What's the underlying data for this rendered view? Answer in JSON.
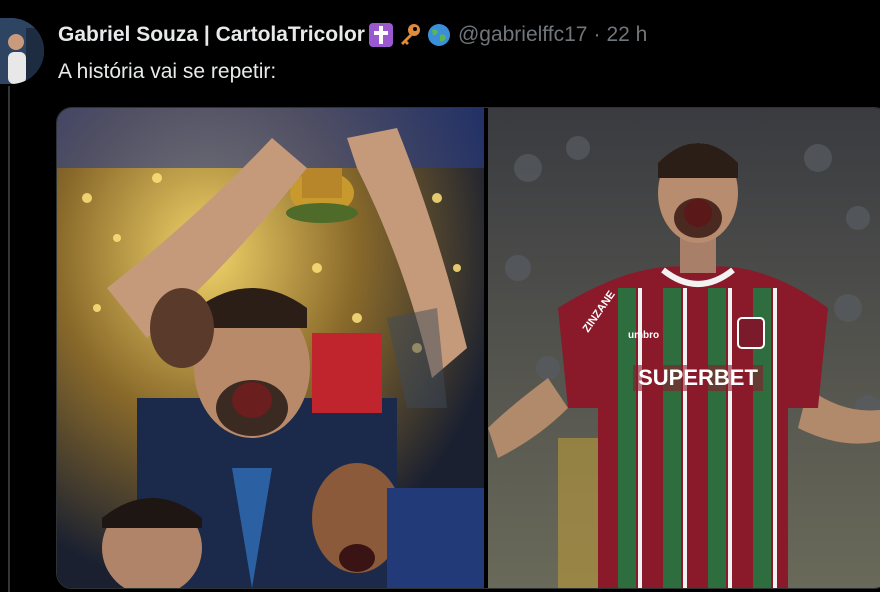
{
  "tweet": {
    "display_name": "Gabriel Souza | CartolaTricolor",
    "handle": "@gabrielffc17",
    "separator": "·",
    "time": "22 h",
    "text": "A história vai se repetir:",
    "badges": [
      "cross-icon",
      "key-icon",
      "globe-icon"
    ]
  },
  "media": {
    "images": [
      {
        "name": "world-cup-celebration-photo",
        "jersey_text": ""
      },
      {
        "name": "fluminense-player-photo",
        "jersey_text": "SUPERBET",
        "sleeve_text": "ZINZANE",
        "kit_brand": "umbro"
      }
    ]
  },
  "colors": {
    "background": "#000000",
    "text_primary": "#e7e9ea",
    "text_secondary": "#71767b",
    "border": "#2f3336"
  }
}
